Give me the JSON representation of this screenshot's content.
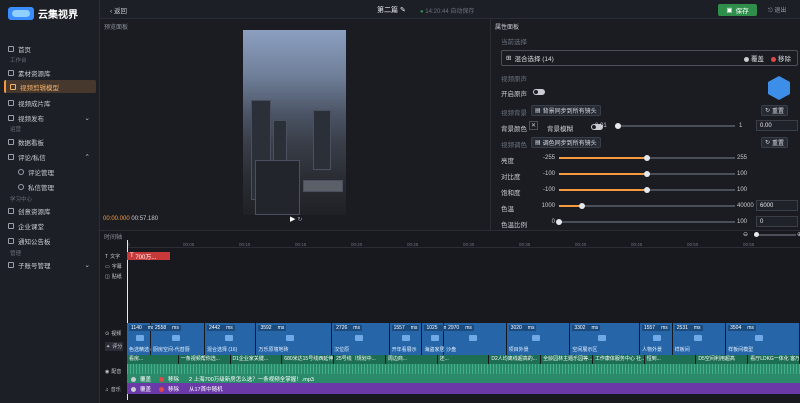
{
  "app": {
    "name": "云集视界"
  },
  "sidebar": {
    "groups": [
      "工作台",
      "运营",
      "学习中心",
      "管理"
    ],
    "items": [
      {
        "label": "首页"
      },
      {
        "label": "素材资源库"
      },
      {
        "label": "视频剪辑模型"
      },
      {
        "label": "视频成片库"
      },
      {
        "label": "视频发布"
      },
      {
        "label": "数据看板"
      },
      {
        "label": "评论/私信"
      },
      {
        "label": "评论管理"
      },
      {
        "label": "私信管理"
      },
      {
        "label": "创意资源库"
      },
      {
        "label": "企业课堂"
      },
      {
        "label": "通知公告板"
      },
      {
        "label": "子账号管理"
      }
    ]
  },
  "topbar": {
    "back_label": "返回",
    "title": "第二篇",
    "status": "14:20:44 自动保存",
    "save_label": "保存",
    "exit_label": "退出"
  },
  "preview": {
    "label": "预览面板",
    "current_time": "00:00.000",
    "total_time": "00:57.180"
  },
  "props": {
    "label": "属性面板",
    "current_selection_label": "当前选择",
    "selection_value": "混合选择 (14)",
    "overlay_label": "覆盖",
    "remove_label": "移除",
    "video_audio_label": "视频原声",
    "enable_audio_label": "开启原声",
    "video_bg_label": "视频背景",
    "sync_bg_label": "背景同步到所有镜头",
    "reset_label": "重置",
    "bg_color_label": "背景颜色",
    "bg_blur_label": "背景模糊",
    "blur_min": "0.01",
    "blur_max": "1",
    "blur_value": "0.00",
    "color_adjust_label": "视频调色",
    "sync_color_label": "调色同步到所有镜头",
    "adjust_rows": [
      {
        "label": "亮度",
        "min": "-255",
        "max": "255",
        "value": 0
      },
      {
        "label": "对比度",
        "min": "-100",
        "max": "100",
        "value": 0
      },
      {
        "label": "饱和度",
        "min": "-100",
        "max": "100",
        "value": 0
      },
      {
        "label": "色温",
        "min": "1000",
        "max": "40000",
        "value": 6000,
        "box": "6000"
      },
      {
        "label": "色温比例",
        "min": "0",
        "max": "100",
        "value": 0,
        "box": "0"
      }
    ]
  },
  "timeline": {
    "label": "时间轴",
    "ticks": [
      "0",
      "00:05",
      "00:10",
      "00:15",
      "00:20",
      "00:25",
      "00:30",
      "00:35",
      "00:40",
      "00:45",
      "00:50",
      "00:55"
    ],
    "track_labels": {
      "text": "文字",
      "subtitle": "字幕",
      "sticker": "贴纸",
      "video": "视频",
      "rate": "评分",
      "voice": "配音",
      "music": "音乐"
    },
    "text_clip": "700万...",
    "video_clips": [
      {
        "dur": "1140",
        "name": "色选精选 (14)"
      },
      {
        "dur": "2558",
        "name": "厨房空间-代替厨"
      },
      {
        "dur": "2442",
        "name": "混合选择 (16)"
      },
      {
        "dur": "3592",
        "name": "万乐原墙地砖"
      },
      {
        "dur": "2726",
        "name": "汉位原"
      },
      {
        "dur": "1557",
        "name": "开年看展示"
      },
      {
        "dur": "1025",
        "name": "海盗家居家"
      },
      {
        "dur": "2970",
        "name": "沙盘"
      },
      {
        "dur": "3020",
        "name": "项目外景"
      },
      {
        "dur": "3302",
        "name": "空间展示区"
      },
      {
        "dur": "1557",
        "name": "人物外景"
      },
      {
        "dur": "2531",
        "name": "样板间"
      },
      {
        "dur": "3504",
        "name": "样板间模型"
      }
    ],
    "ms_label": "ms",
    "subtitle_segments": [
      "看房...",
      "一条视频帮你选...",
      "D1企业家关键...",
      "680米达15号线西延伸...",
      "25号线（规划中...",
      "周边商...",
      "还...",
      "D2人均离线超高的...",
      "全龄园林主题乐园等...",
      "工作康体服务中心 社...",
      "恒到...",
      "D5空间利用超高",
      "看厅LDKG一体化 客厅..."
    ],
    "voice_overlay": "覆盖",
    "voice_remove": "移除",
    "voice_text": "2 上海700万级新房怎么选？一条视频全掌握！.mp3",
    "music_overlay": "覆盖",
    "music_remove": "移除",
    "music_text": "从17首中随机"
  },
  "colors": {
    "accent": "#f59a40",
    "save": "#2f8f4a",
    "video_track": "#2565a8",
    "audio_track": "#2a8a6a",
    "music_track": "#6b3aa8",
    "text_clip": "#c83a3a"
  }
}
